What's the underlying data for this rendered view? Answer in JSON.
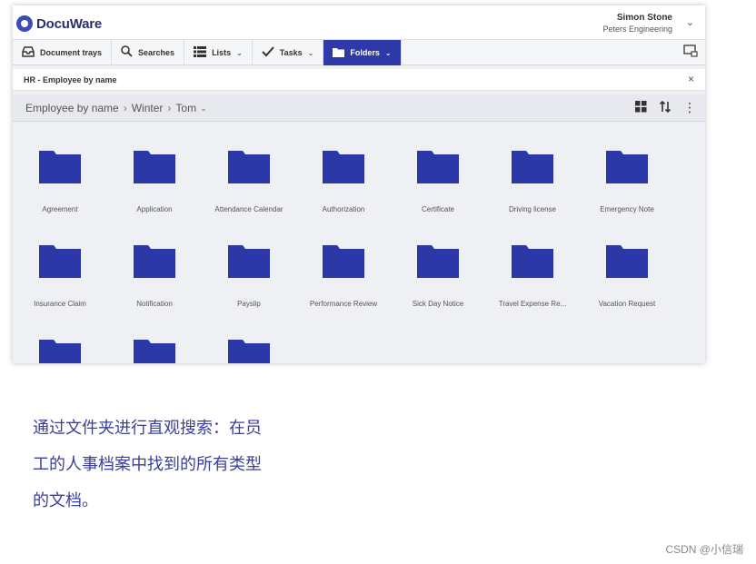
{
  "header": {
    "app_name": "DocuWare",
    "user_name": "Simon Stone",
    "organization": "Peters Engineering"
  },
  "toolbar": {
    "items": [
      {
        "label": "Document trays",
        "icon": "tray-icon"
      },
      {
        "label": "Searches",
        "icon": "search-icon"
      },
      {
        "label": "Lists",
        "icon": "list-icon"
      },
      {
        "label": "Tasks",
        "icon": "check-icon"
      },
      {
        "label": "Folders",
        "icon": "folder-icon"
      }
    ],
    "active": "Folders"
  },
  "strip": {
    "title": "HR - Employee by name"
  },
  "breadcrumb": [
    "Employee by name",
    "Winter",
    "Tom"
  ],
  "folders": [
    "Agreement",
    "Application",
    "Attendance Calendar",
    "Authorization",
    "Certificate",
    "Driving license",
    "Emergency Note",
    "Insurance Claim",
    "Notification",
    "Payslip",
    "Performance Review",
    "Sick Day Notice",
    "Travel Expense Re...",
    "Vacation Request",
    "",
    "",
    ""
  ],
  "caption": {
    "line1": "通过文件夹进行直观搜索：在员",
    "line2": "工的人事档案中找到的所有类型",
    "line3": "的文档。"
  },
  "watermark": "CSDN @小信瑞",
  "colors": {
    "folder": "#2c37a8",
    "accent": "#2f3aa8",
    "caption": "#3a3f9e"
  }
}
